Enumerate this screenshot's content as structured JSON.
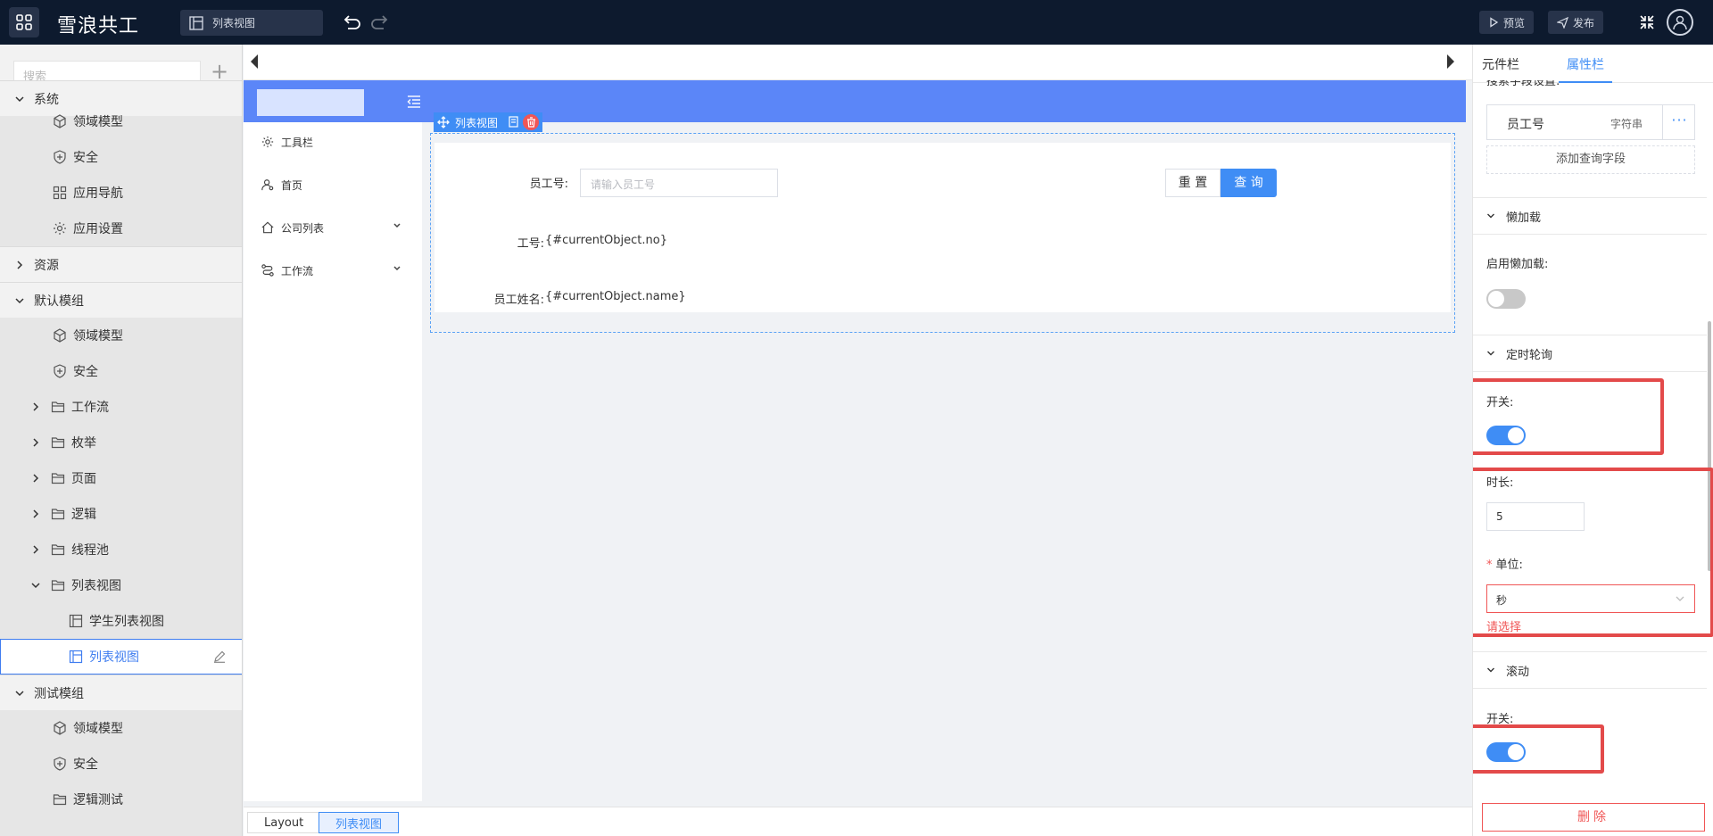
{
  "topbar": {
    "brand": "雪浪共工",
    "page_chip": "列表视图",
    "preview_label": "预览",
    "publish_label": "发布"
  },
  "sidebar": {
    "search_placeholder": "搜索",
    "partial_top_label": "系统",
    "items": [
      {
        "label": "领域模型",
        "icon": "cube-icon"
      },
      {
        "label": "安全",
        "icon": "shield-icon"
      },
      {
        "label": "应用导航",
        "icon": "grid-icon"
      },
      {
        "label": "应用设置",
        "icon": "gear-icon"
      },
      {
        "label": "资源",
        "icon": "chevron-right-icon"
      },
      {
        "label": "默认模组",
        "icon": "chevron-down-icon"
      },
      {
        "label": "领域模型",
        "icon": "cube-icon"
      },
      {
        "label": "安全",
        "icon": "shield-icon"
      },
      {
        "label": "工作流",
        "icon": "folder-icon"
      },
      {
        "label": "枚举",
        "icon": "folder-icon"
      },
      {
        "label": "页面",
        "icon": "folder-icon"
      },
      {
        "label": "逻辑",
        "icon": "folder-icon"
      },
      {
        "label": "线程池",
        "icon": "folder-icon"
      },
      {
        "label": "列表视图",
        "icon": "folder-icon"
      },
      {
        "label": "学生列表视图",
        "icon": "list-view-icon"
      },
      {
        "label": "列表视图",
        "icon": "list-view-icon"
      },
      {
        "label": "测试模组",
        "icon": "chevron-down-icon"
      },
      {
        "label": "领域模型",
        "icon": "cube-icon"
      },
      {
        "label": "安全",
        "icon": "shield-icon"
      },
      {
        "label": "逻辑测试",
        "icon": "folder-icon"
      }
    ]
  },
  "canvas": {
    "nav": [
      {
        "label": "工具栏",
        "icon": "gear-icon"
      },
      {
        "label": "首页",
        "icon": "user-icon"
      },
      {
        "label": "公司列表",
        "icon": "home-icon"
      },
      {
        "label": "工作流",
        "icon": "flow-icon"
      }
    ],
    "component_label": "列表视图",
    "search_label": "员工号:",
    "search_placeholder": "请输入员工号",
    "reset_label": "重 置",
    "query_label": "查 询",
    "field1_label": "工号:",
    "field1_value": "{#currentObject.no}",
    "field2_label": "员工姓名:",
    "field2_value": "{#currentObject.name}"
  },
  "footer": {
    "crumb1": "Layout",
    "crumb2": "列表视图"
  },
  "props": {
    "tab1": "元件栏",
    "tab2": "属性栏",
    "partial_label": "搜索字段设置:",
    "field_name": "员工号",
    "field_type": "字符串",
    "more": "···",
    "add_query": "添加查询字段",
    "lazy_section": "懒加载",
    "lazy_label": "启用懒加载:",
    "lazy_on": false,
    "poll_section": "定时轮询",
    "poll_switch_label": "开关:",
    "poll_on": true,
    "duration_label": "时长:",
    "duration_value": "5",
    "required_mark": "*",
    "unit_label": "单位:",
    "unit_value": "秒",
    "unit_error": "请选择",
    "scroll_section": "滚动",
    "scroll_switch_label": "开关:",
    "scroll_on": true,
    "delete_label": "删除"
  },
  "colors": {
    "primary": "#3f8df5",
    "topbar": "#0d1a2e",
    "highlight": "#e34a4a",
    "header_blue": "#5b86f8"
  }
}
